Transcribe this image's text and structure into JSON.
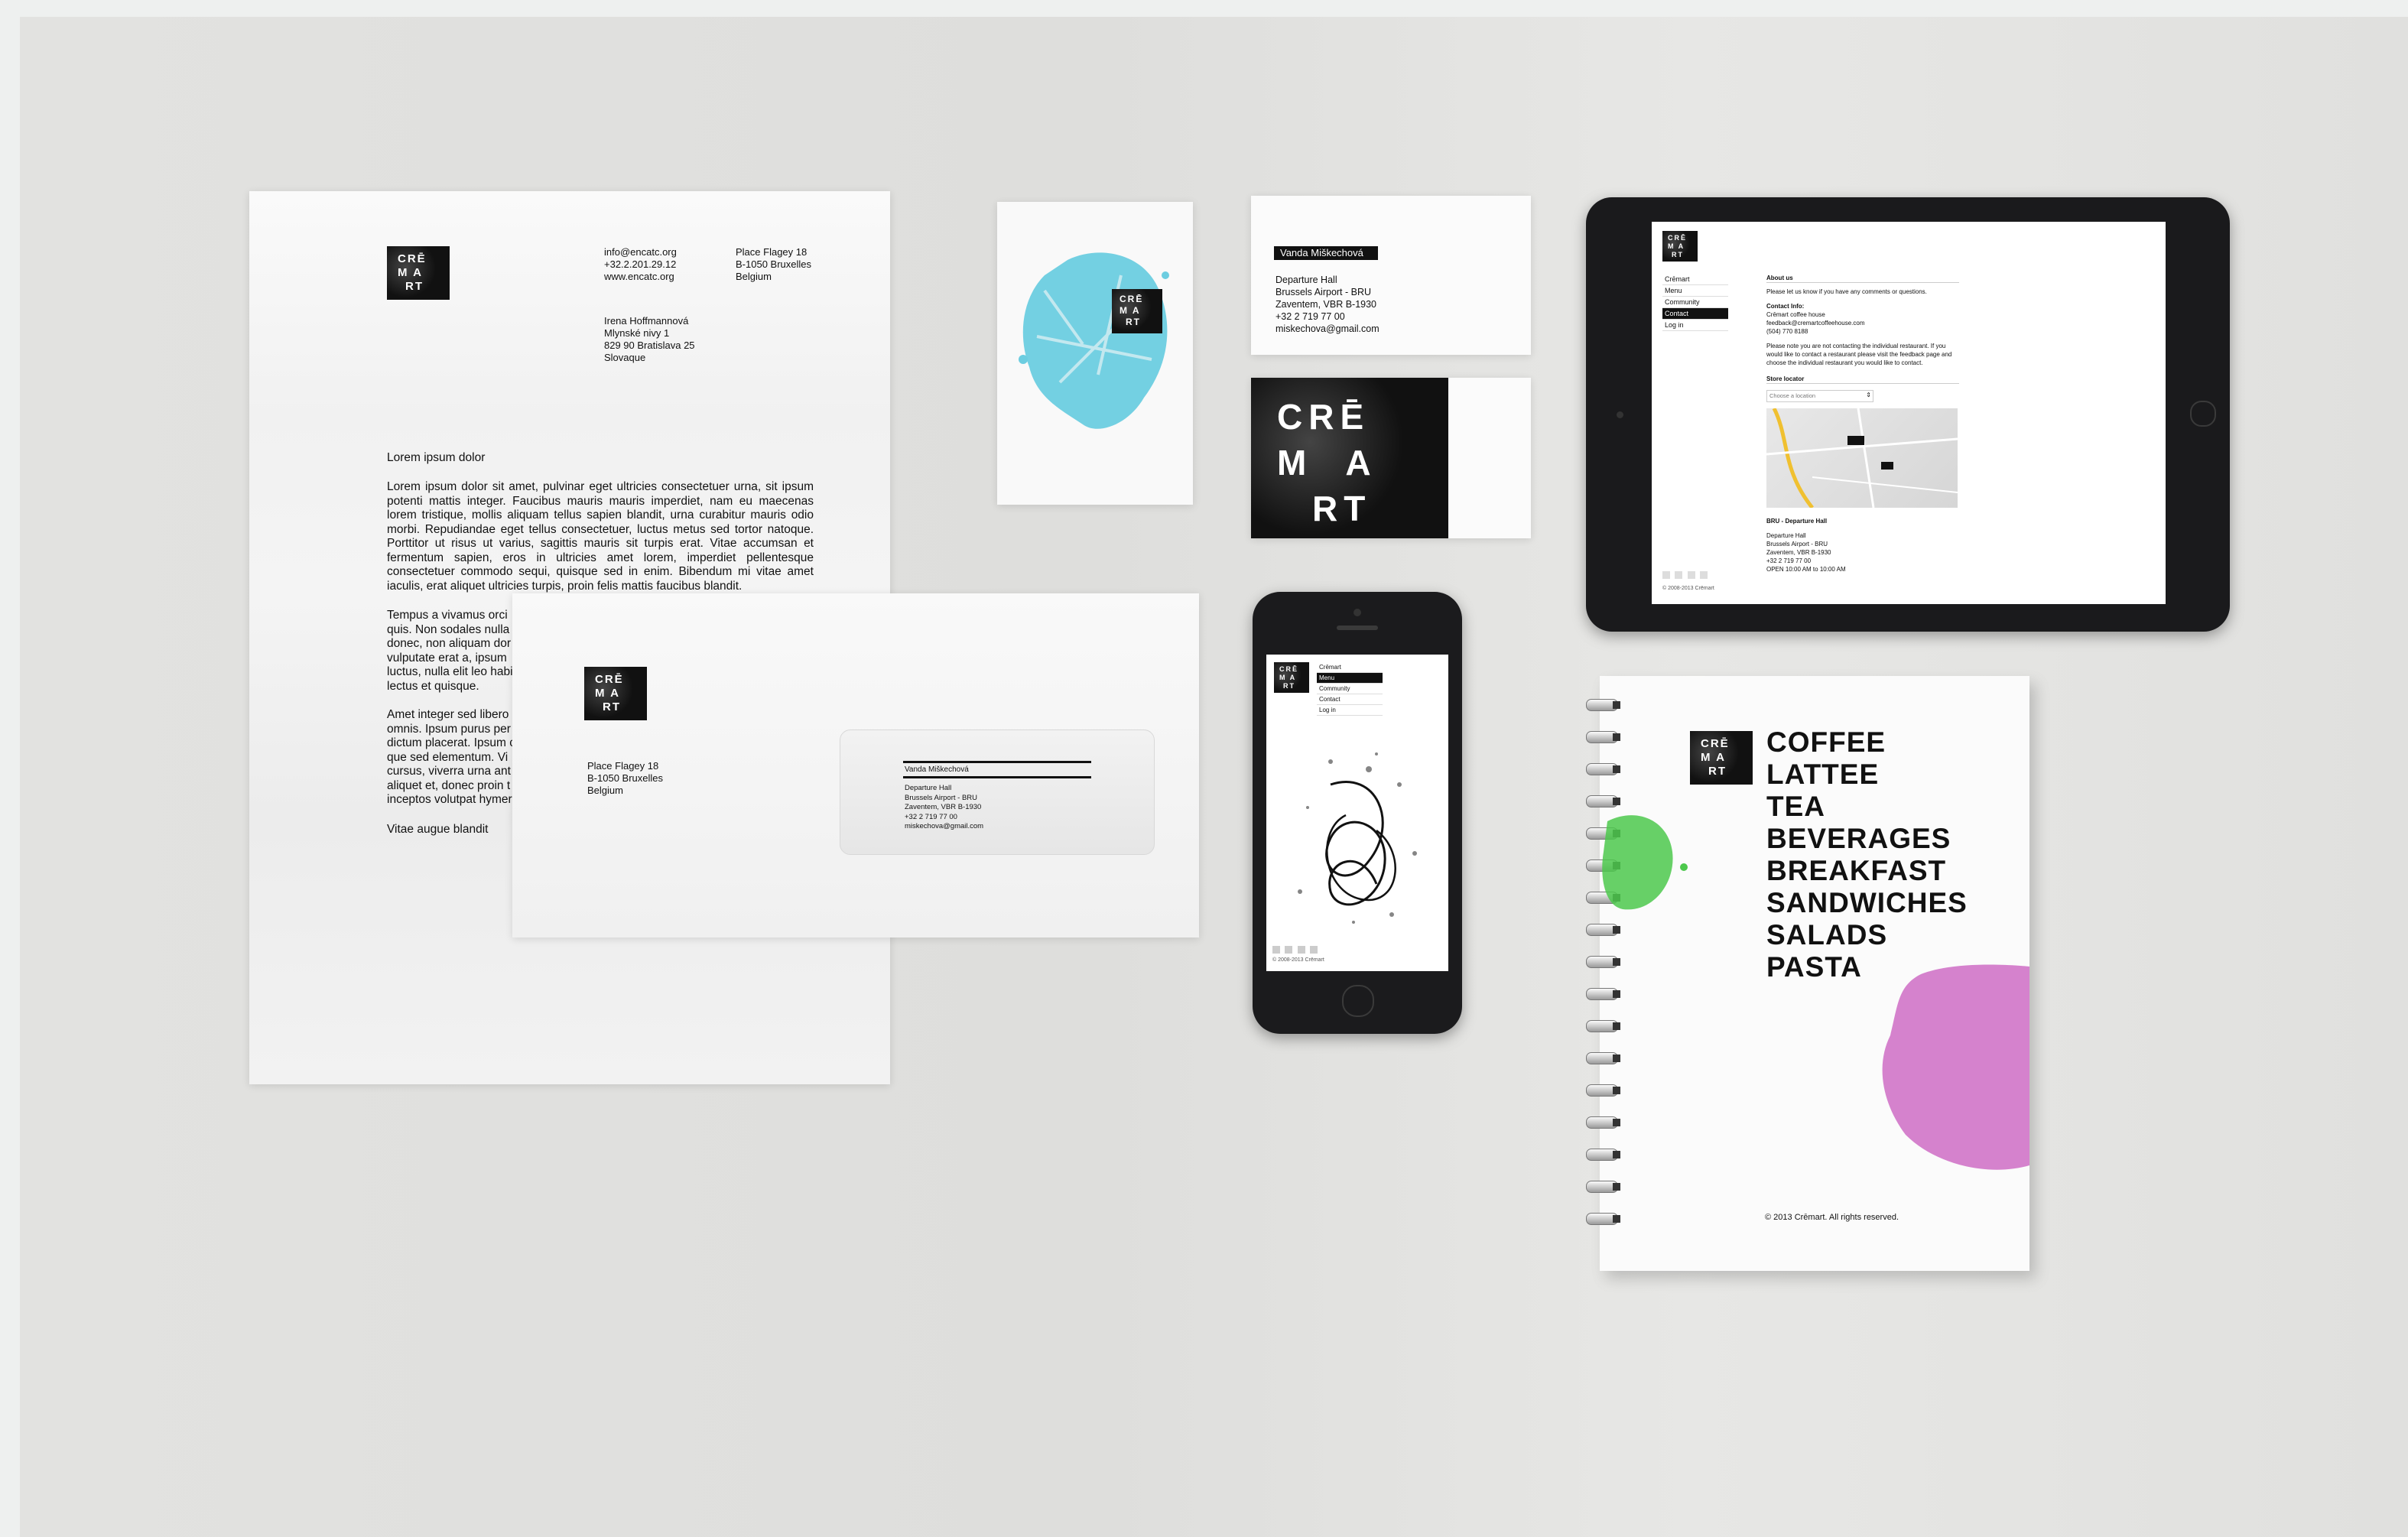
{
  "brand": {
    "logo_lines": [
      "CRĒ",
      "M A",
      "RT"
    ]
  },
  "letterhead": {
    "contact_email": "info@encatc.org",
    "contact_phone": "+32.2.201.29.12",
    "contact_web": "www.encatc.org",
    "sender_address": [
      "Place Flagey 18",
      "B-1050 Bruxelles",
      "Belgium"
    ],
    "recipient": [
      "Irena Hoffmannová",
      "Mlynské nivy 1",
      "829 90 Bratislava 25",
      "Slovaque"
    ],
    "subject": "Lorem ipsum dolor",
    "para1": "Lorem ipsum dolor sit amet, pulvinar eget ultricies consectetuer urna, sit ipsum potenti mattis integer. Faucibus mauris mauris imperdiet, nam eu maecenas lorem tristique, mollis aliquam tellus sapien blandit, urna curabitur mauris odio morbi. Repudiandae eget tellus consectetuer, luctus metus sed tortor natoque. Porttitor ut risus ut varius, sagittis mauris sit turpis erat. Vitae accumsan et fermentum sapien, eros in ultricies amet lorem, imperdiet pellentesque consectetuer commodo sequi, quisque sed in enim. Bibendum mi vitae amet iaculis, erat aliquet ultricies turpis, proin felis mattis faucibus blandit.",
    "para2_lines": [
      "Tempus a vivamus orci",
      "quis. Non sodales nulla",
      "donec, non aliquam dor",
      "vulputate erat a, ipsum",
      "luctus, nulla elit leo habi",
      "lectus et quisque."
    ],
    "para3_lines": [
      "Amet integer sed libero",
      "omnis. Ipsum purus per",
      "dictum placerat. Ipsum c",
      "que sed elementum. Vi",
      "cursus, viverra urna ant",
      "aliquet et, donec proin t",
      "inceptos volutpat hymer"
    ],
    "closing": "Vitae augue blandit"
  },
  "envelope": {
    "sender_address": [
      "Place Flagey 18",
      "B-1050 Bruxelles",
      "Belgium"
    ],
    "window_name": "Vanda Miškechová",
    "window_lines": [
      "Departure Hall",
      "Brussels Airport - BRU",
      "Zaventem, VBR B-1930",
      "+32 2 719 77 00",
      "miskechova@gmail.com"
    ]
  },
  "business_card": {
    "name": "Vanda Miškechová",
    "lines": [
      "Departure Hall",
      "Brussels Airport - BRU",
      "Zaventem, VBR B-1930",
      "+32 2 719 77 00",
      "miskechova@gmail.com"
    ]
  },
  "tablet": {
    "nav": [
      "Crēmart",
      "Menu",
      "Community",
      "Contact",
      "Log in"
    ],
    "nav_active_index": 3,
    "heading": "About us",
    "intro": "Please let us know if you have any comments or questions.",
    "contact_heading": "Contact Info:",
    "contact_lines": [
      "Crēmart coffee house",
      "feedback@cremartcoffeehouse.com",
      "(504) 770 8188"
    ],
    "note": "Please note you are not contacting the individual restaurant. If you would like to contact a restaurant please visit the feedback page and choose the individual restaurant you would like to contact.",
    "store_locator": "Store locator",
    "location_placeholder": "Choose a location",
    "store_name": "BRU - Departure Hall",
    "store_lines": [
      "Departure Hall",
      "Brussels Airport - BRU",
      "Zaventem, VBR B-1930",
      "+32 2 719 77 00",
      "OPEN 10:00 AM to 10:00 AM"
    ],
    "footer": "© 2008-2013 Crēmart"
  },
  "phone": {
    "nav": [
      "Crēmart",
      "Menu",
      "Community",
      "Contact",
      "Log in"
    ],
    "nav_active_index": 1,
    "footer": "© 2008-2013 Crēmart"
  },
  "notebook": {
    "menu": [
      "COFFEE",
      "LATTEE",
      "TEA",
      "BEVERAGES",
      "BREAKFAST",
      "SANDWICHES",
      "SALADS",
      "PASTA"
    ],
    "footer": "© 2013 Crēmart. All rights reserved."
  },
  "colors": {
    "stage": "#e0e0de",
    "blue_splash": "#6ccde0",
    "green_splash": "#4cc84c",
    "pink_splash": "#d074c8",
    "ink": "#111111"
  }
}
